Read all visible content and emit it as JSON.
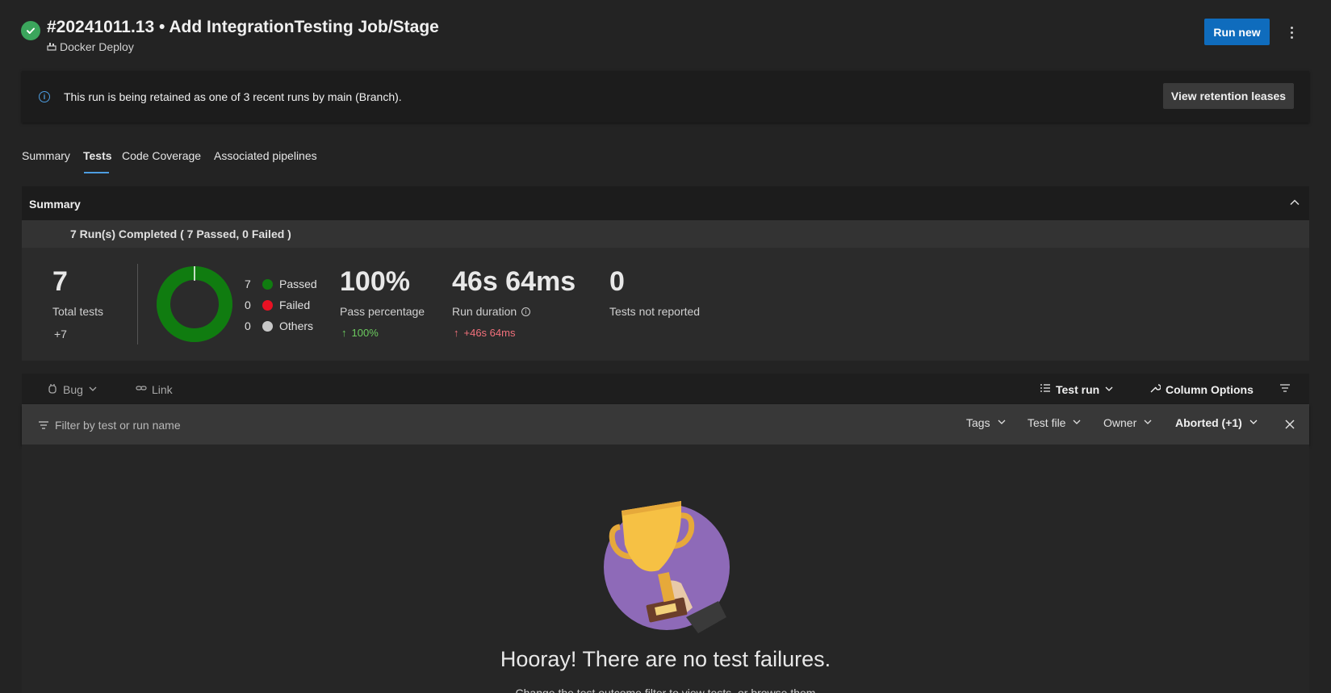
{
  "header": {
    "title": "#20241011.13 • Add IntegrationTesting Job/Stage",
    "pipeline_name": "Docker Deploy",
    "run_new_label": "Run new"
  },
  "banner": {
    "message": "This run is being retained as one of 3 recent runs by main (Branch).",
    "button_label": "View retention leases"
  },
  "tabs": [
    {
      "label": "Summary",
      "active": false
    },
    {
      "label": "Tests",
      "active": true
    },
    {
      "label": "Code Coverage",
      "active": false
    },
    {
      "label": "Associated pipelines",
      "active": false
    }
  ],
  "summary": {
    "title": "Summary",
    "runs_completed": "7 Run(s) Completed ( 7 Passed, 0 Failed )",
    "total_tests": {
      "value": "7",
      "label": "Total tests",
      "delta": "+7"
    },
    "outcome": {
      "passed": {
        "count": "7",
        "label": "Passed",
        "color": "#107c10"
      },
      "failed": {
        "count": "0",
        "label": "Failed",
        "color": "#e81123"
      },
      "others": {
        "count": "0",
        "label": "Others",
        "color": "#c8c8c8"
      },
      "passed_fraction": 1.0
    },
    "pass_percentage": {
      "value": "100%",
      "label": "Pass percentage",
      "delta": "100%",
      "delta_color": "#6ccb5f"
    },
    "run_duration": {
      "value": "46s 64ms",
      "label": "Run duration",
      "delta": "+46s 64ms",
      "delta_color": "#f1707b"
    },
    "not_reported": {
      "value": "0",
      "label": "Tests not reported"
    }
  },
  "toolbar": {
    "bug_label": "Bug",
    "link_label": "Link",
    "test_run_label": "Test run",
    "column_options_label": "Column Options"
  },
  "filter": {
    "placeholder": "Filter by test or run name",
    "tags_label": "Tags",
    "test_file_label": "Test file",
    "owner_label": "Owner",
    "outcome_label": "Aborted (+1)"
  },
  "empty_state": {
    "title": "Hooray! There are no test failures.",
    "subtitle": "Change the test outcome filter to view tests, or browse them"
  }
}
